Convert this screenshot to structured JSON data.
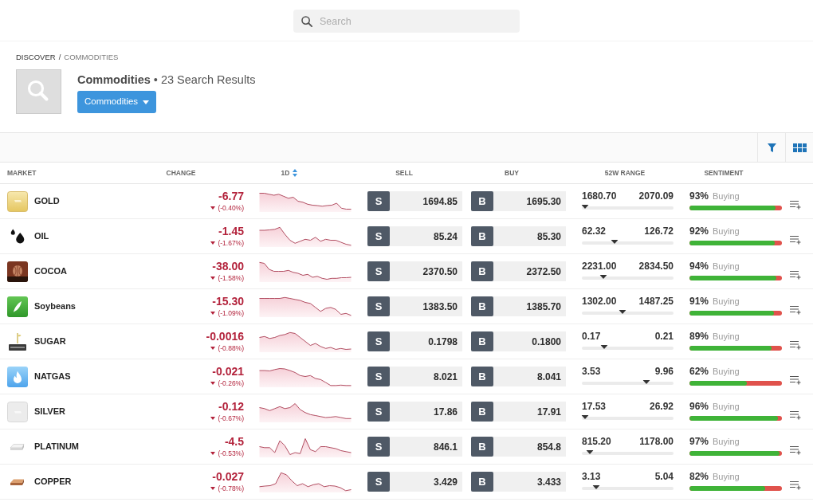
{
  "search": {
    "placeholder": "Search"
  },
  "breadcrumb": {
    "items": [
      {
        "label": "DISCOVER",
        "current": false
      },
      {
        "label": "COMMODITIES",
        "current": true
      }
    ],
    "separator": "/"
  },
  "header": {
    "title": "Commodities",
    "results": "• 23 Search Results",
    "filter_button": "Commodities"
  },
  "columns": [
    {
      "label": "MARKET",
      "sorted": false
    },
    {
      "label": "CHANGE",
      "sorted": false
    },
    {
      "label": "1D",
      "sorted": true
    },
    {
      "label": "SELL",
      "sorted": false
    },
    {
      "label": "BUY",
      "sorted": false
    },
    {
      "label": "52W RANGE",
      "sorted": false
    },
    {
      "label": "SENTIMENT",
      "sorted": false
    }
  ],
  "rows": [
    {
      "name": "GOLD",
      "change": "-6.77",
      "change_percent": "(-0.40%)",
      "falling": true,
      "sell_label": "S",
      "sell": "1694.85",
      "buy_label": "B",
      "buy": "1695.30",
      "range": {
        "low": "1680.70",
        "high": "2070.09",
        "level": 0.036
      },
      "sentiment": {
        "percent": "93%",
        "label": "Buying",
        "level": 0.93
      }
    },
    {
      "name": "OIL",
      "change": "-1.45",
      "change_percent": "(-1.67%)",
      "falling": true,
      "sell_label": "S",
      "sell": "85.24",
      "buy_label": "B",
      "buy": "85.30",
      "range": {
        "low": "62.32",
        "high": "126.72",
        "level": 0.356
      },
      "sentiment": {
        "percent": "92%",
        "label": "Buying",
        "level": 0.92
      }
    },
    {
      "name": "COCOA",
      "change": "-38.00",
      "change_percent": "(-1.58%)",
      "falling": true,
      "sell_label": "S",
      "sell": "2370.50",
      "buy_label": "B",
      "buy": "2372.50",
      "range": {
        "low": "2231.00",
        "high": "2834.50",
        "level": 0.231
      },
      "sentiment": {
        "percent": "94%",
        "label": "Buying",
        "level": 0.94
      }
    },
    {
      "name": "Soybeans",
      "change": "-15.30",
      "change_percent": "(-1.09%)",
      "falling": true,
      "sell_label": "S",
      "sell": "1383.50",
      "buy_label": "B",
      "buy": "1385.70",
      "range": {
        "low": "1302.00",
        "high": "1487.25",
        "level": 0.44
      },
      "sentiment": {
        "percent": "91%",
        "label": "Buying",
        "level": 0.91
      }
    },
    {
      "name": "SUGAR",
      "change": "-0.0016",
      "change_percent": "(-0.88%)",
      "falling": true,
      "sell_label": "S",
      "sell": "0.1798",
      "buy_label": "B",
      "buy": "0.1800",
      "range": {
        "low": "0.17",
        "high": "0.21",
        "level": 0.245
      },
      "sentiment": {
        "percent": "89%",
        "label": "Buying",
        "level": 0.89
      }
    },
    {
      "name": "NATGAS",
      "change": "-0.021",
      "change_percent": "(-0.26%)",
      "falling": true,
      "sell_label": "S",
      "sell": "8.021",
      "buy_label": "B",
      "buy": "8.041",
      "range": {
        "low": "3.53",
        "high": "9.96",
        "level": 0.7
      },
      "sentiment": {
        "percent": "62%",
        "label": "Buying",
        "level": 0.62
      }
    },
    {
      "name": "SILVER",
      "change": "-0.12",
      "change_percent": "(-0.67%)",
      "falling": true,
      "sell_label": "S",
      "sell": "17.86",
      "buy_label": "B",
      "buy": "17.91",
      "range": {
        "low": "17.53",
        "high": "26.92",
        "level": 0.035
      },
      "sentiment": {
        "percent": "96%",
        "label": "Buying",
        "level": 0.96
      }
    },
    {
      "name": "PLATINUM",
      "change": "-4.5",
      "change_percent": "(-0.53%)",
      "falling": true,
      "sell_label": "S",
      "sell": "846.1",
      "buy_label": "B",
      "buy": "854.8",
      "range": {
        "low": "815.20",
        "high": "1178.00",
        "level": 0.085
      },
      "sentiment": {
        "percent": "97%",
        "label": "Buying",
        "level": 0.97
      }
    },
    {
      "name": "COPPER",
      "change": "-0.027",
      "change_percent": "(-0.78%)",
      "falling": true,
      "sell_label": "S",
      "sell": "3.429",
      "buy_label": "B",
      "buy": "3.433",
      "range": {
        "low": "3.13",
        "high": "5.04",
        "level": 0.157
      },
      "sentiment": {
        "percent": "82%",
        "label": "Buying",
        "level": 0.82
      }
    }
  ]
}
